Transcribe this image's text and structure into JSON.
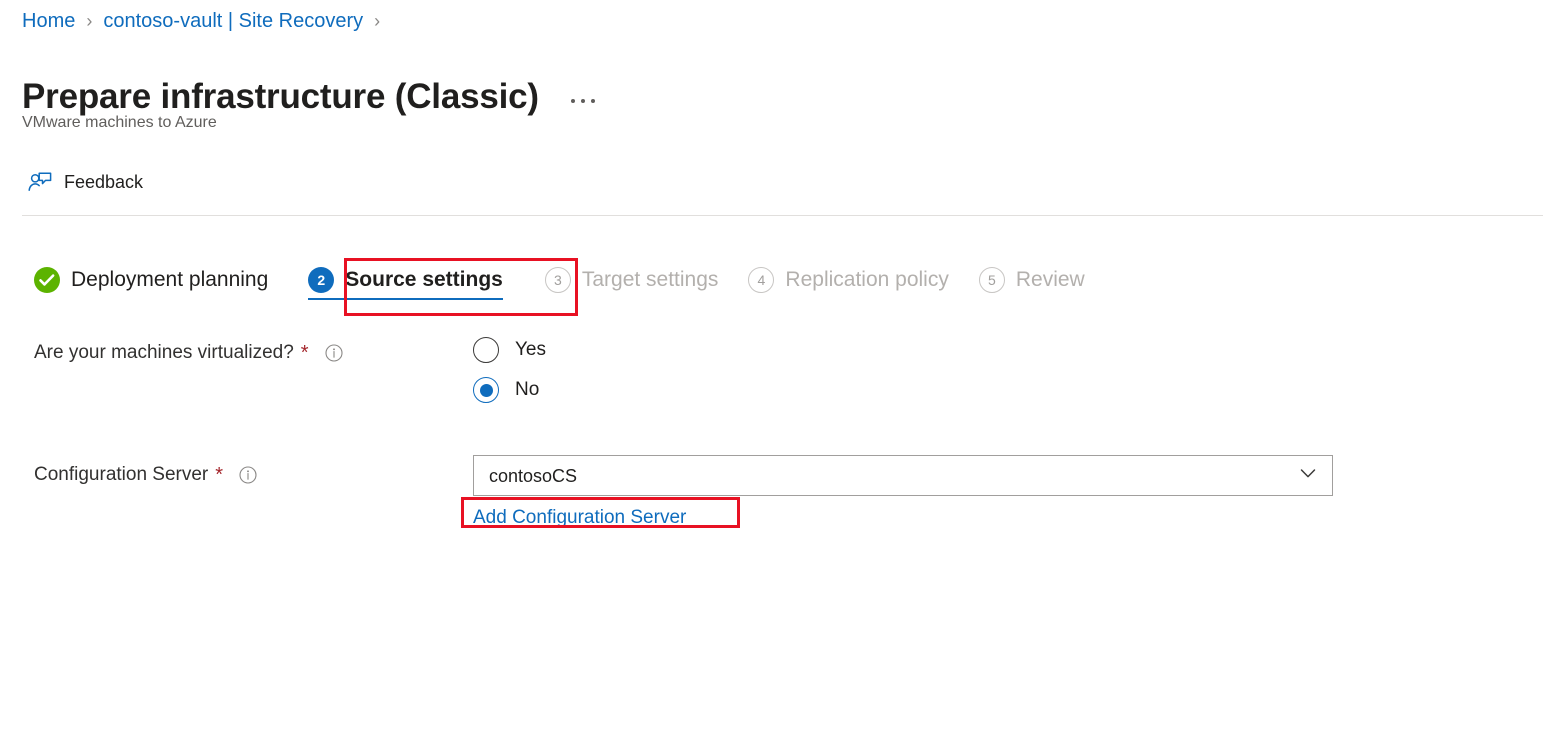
{
  "breadcrumb": {
    "items": [
      {
        "label": "Home"
      },
      {
        "label": "contoso-vault | Site Recovery"
      }
    ],
    "separator": "›"
  },
  "header": {
    "title": "Prepare infrastructure (Classic)",
    "subtitle": "VMware machines to Azure",
    "more_menu_icon": "ellipsis-icon"
  },
  "commandbar": {
    "items": [
      {
        "label": "Feedback",
        "icon": "feedback-person-icon"
      }
    ]
  },
  "wizard": {
    "steps": [
      {
        "number": "",
        "label": "Deployment planning",
        "state": "completed",
        "icon": "check-circle-icon"
      },
      {
        "number": "2",
        "label": "Source settings",
        "state": "current"
      },
      {
        "number": "3",
        "label": "Target settings",
        "state": "disabled"
      },
      {
        "number": "4",
        "label": "Replication policy",
        "state": "disabled"
      },
      {
        "number": "5",
        "label": "Review",
        "state": "disabled"
      }
    ]
  },
  "form": {
    "virtualized": {
      "label": "Are your machines virtualized?",
      "required_marker": "*",
      "info_icon": "info-icon",
      "options": [
        {
          "label": "Yes",
          "selected": false
        },
        {
          "label": "No",
          "selected": true
        }
      ]
    },
    "configuration_server": {
      "label": "Configuration Server",
      "required_marker": "*",
      "info_icon": "info-icon",
      "selected_value": "contosoCS",
      "chevron_icon": "chevron-down-icon",
      "add_link": "Add Configuration Server"
    }
  },
  "annotations": {
    "highlight_color": "#e81123",
    "boxes": [
      {
        "target": "Source settings"
      },
      {
        "target": "Add Configuration Server"
      }
    ]
  },
  "colors": {
    "link": "#0f6cbd",
    "accent": "#0f6cbd",
    "success": "#5cb300",
    "required": "#a4262c",
    "annotation": "#e81123"
  }
}
